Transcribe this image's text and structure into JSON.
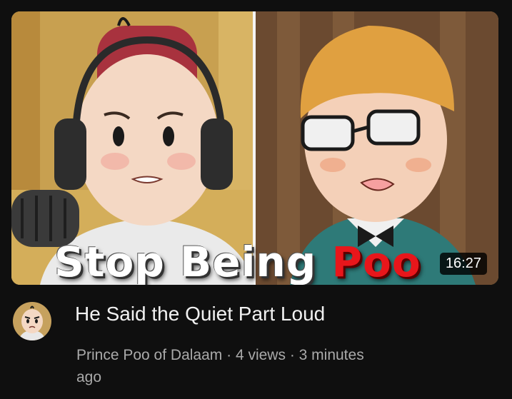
{
  "thumbnail": {
    "overlay_word_1": "Stop Being",
    "overlay_word_2": "Poo",
    "duration": "16:27"
  },
  "video": {
    "title": "He Said the Quiet Part Loud"
  },
  "channel": {
    "name": "Prince Poo of Dalaam",
    "separator": " · ",
    "views": "4 views",
    "time_ago_1": "3 minutes",
    "time_ago_2": "ago"
  },
  "colors": {
    "background": "#0f0f0f",
    "overlay_red": "#e8161b",
    "meta_text": "#aaaaaa"
  }
}
